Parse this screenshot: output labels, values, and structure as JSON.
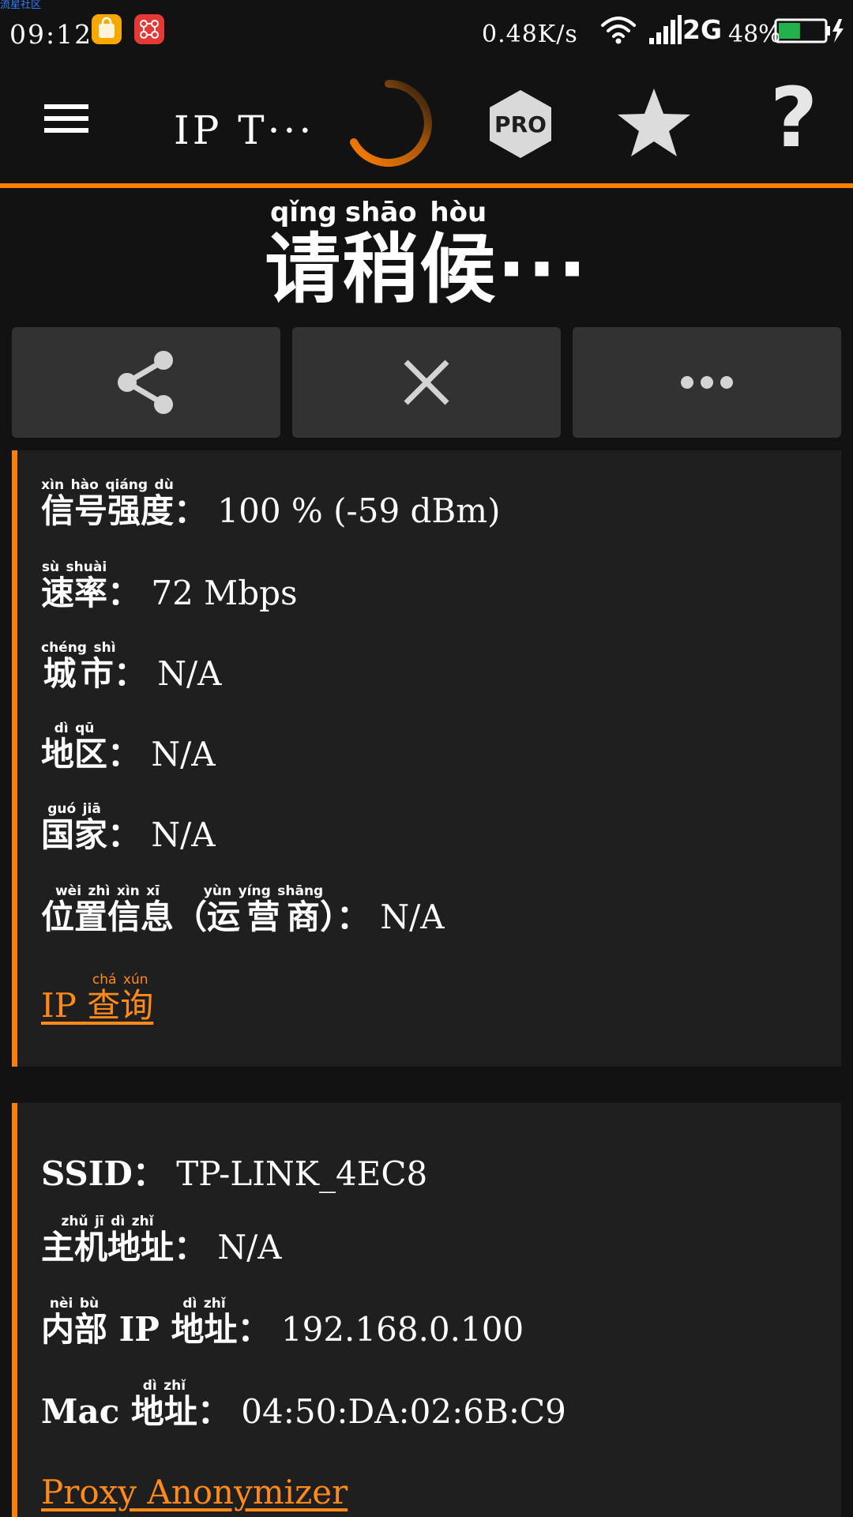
{
  "watermark": "流星社区",
  "status_bar": {
    "time": "09:12",
    "app_icons": [
      "shopping-bag-icon",
      "app-network-icon"
    ],
    "net_speed": "0.48K/s",
    "network_type": "2G",
    "battery_percent": "48%",
    "battery_level": 0.48,
    "colors": {
      "app1": "#f7a800",
      "app2": "#e53935",
      "battery": "#22b14c"
    }
  },
  "toolbar": {
    "title": "IP T···",
    "icons": [
      "menu-icon",
      "loading-spinner-icon",
      "pro-badge-icon",
      "star-icon",
      "help-icon"
    ],
    "pro_label": "PRO",
    "help_label": "?"
  },
  "heading": {
    "chars": [
      "请",
      "稍",
      "候"
    ],
    "pinyin": [
      "qǐng",
      "shāo",
      "hòu"
    ],
    "ellipsis": "···"
  },
  "actions": {
    "icons": [
      "share-icon",
      "close-icon",
      "more-icon"
    ]
  },
  "card1": {
    "rows": [
      {
        "label": "信号强度",
        "pinyin": [
          "xìn",
          "hào",
          "qiáng",
          "dù"
        ],
        "colon": "：",
        "value": "100 % (-59 dBm)"
      },
      {
        "label": "速率",
        "pinyin": [
          "sù",
          "shuài"
        ],
        "colon": "：",
        "value": "72 Mbps"
      },
      {
        "label": "城市",
        "pinyin": [
          "chéng",
          "shì"
        ],
        "colon": "：",
        "value": "N/A"
      },
      {
        "label": "地区",
        "pinyin": [
          "dì",
          "qū"
        ],
        "colon": "：",
        "value": "N/A"
      },
      {
        "label": "国家",
        "pinyin": [
          "guó",
          "jiā"
        ],
        "colon": "：",
        "value": "N/A"
      }
    ],
    "location": {
      "label1": "位置信息",
      "pinyin1": [
        "wèi",
        "zhì",
        "xìn",
        "xī"
      ],
      "paren_open": "（",
      "label2": "运营商",
      "pinyin2": [
        "yùn",
        "yíng",
        "shāng"
      ],
      "paren_close": "）",
      "colon": "：",
      "value": "N/A"
    },
    "link": {
      "prefix": "IP",
      "chars": "查询",
      "pinyin": [
        "chá",
        "xún"
      ]
    }
  },
  "card2": {
    "ssid": {
      "label": "SSID",
      "colon": "：",
      "value": "TP-LINK_4EC8"
    },
    "host": {
      "label": "主机地址",
      "pinyin": [
        "zhǔ",
        "jī",
        "dì",
        "zhǐ"
      ],
      "colon": "：",
      "value": "N/A"
    },
    "internal_ip": {
      "label1": "内部",
      "pinyin1": [
        "nèi",
        "bù"
      ],
      "middle": "IP",
      "label2": "地址",
      "pinyin2": [
        "dì",
        "zhǐ"
      ],
      "colon": "：",
      "value": "192.168.0.100"
    },
    "mac": {
      "prefix": "Mac",
      "label": "地址",
      "pinyin": [
        "dì",
        "zhǐ"
      ],
      "colon": "：",
      "value": "04:50:DA:02:6B:C9"
    },
    "link": "Proxy Anonymizer"
  },
  "theme": {
    "accent": "#ff7f00",
    "background": "#121212",
    "card": "#1f1f1f",
    "button": "#323232"
  }
}
